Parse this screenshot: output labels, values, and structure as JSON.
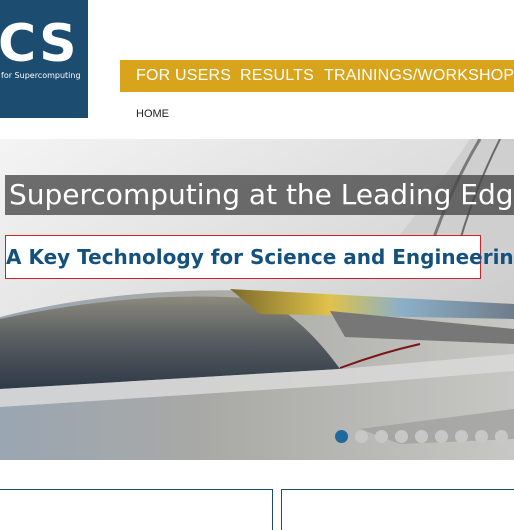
{
  "logo": {
    "text": "CS",
    "subtitle": "for Supercomputing"
  },
  "nav": {
    "items": [
      "FOR USERS",
      "RESULTS",
      "TRAININGS/WORKSHOPS"
    ]
  },
  "breadcrumb": {
    "home": "HOME"
  },
  "hero": {
    "title": "Supercomputing at the Leading Edge",
    "subtitle": "A Key Technology for Science and Engineering",
    "slide_count": 9,
    "active_slide": 1
  },
  "colors": {
    "brand_blue": "#1c4c70",
    "nav_gold": "#d8a41b",
    "accent_red": "#c8242c",
    "subtitle_blue": "#14527d"
  }
}
